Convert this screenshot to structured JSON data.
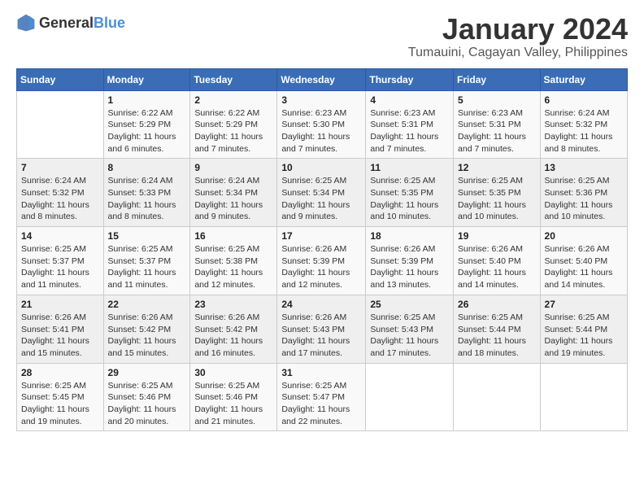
{
  "logo": {
    "text_general": "General",
    "text_blue": "Blue"
  },
  "title": {
    "month": "January 2024",
    "location": "Tumauini, Cagayan Valley, Philippines"
  },
  "weekdays": [
    "Sunday",
    "Monday",
    "Tuesday",
    "Wednesday",
    "Thursday",
    "Friday",
    "Saturday"
  ],
  "weeks": [
    [
      {
        "day": "",
        "info": ""
      },
      {
        "day": "1",
        "info": "Sunrise: 6:22 AM\nSunset: 5:29 PM\nDaylight: 11 hours\nand 6 minutes."
      },
      {
        "day": "2",
        "info": "Sunrise: 6:22 AM\nSunset: 5:29 PM\nDaylight: 11 hours\nand 7 minutes."
      },
      {
        "day": "3",
        "info": "Sunrise: 6:23 AM\nSunset: 5:30 PM\nDaylight: 11 hours\nand 7 minutes."
      },
      {
        "day": "4",
        "info": "Sunrise: 6:23 AM\nSunset: 5:31 PM\nDaylight: 11 hours\nand 7 minutes."
      },
      {
        "day": "5",
        "info": "Sunrise: 6:23 AM\nSunset: 5:31 PM\nDaylight: 11 hours\nand 7 minutes."
      },
      {
        "day": "6",
        "info": "Sunrise: 6:24 AM\nSunset: 5:32 PM\nDaylight: 11 hours\nand 8 minutes."
      }
    ],
    [
      {
        "day": "7",
        "info": "Sunrise: 6:24 AM\nSunset: 5:32 PM\nDaylight: 11 hours\nand 8 minutes."
      },
      {
        "day": "8",
        "info": "Sunrise: 6:24 AM\nSunset: 5:33 PM\nDaylight: 11 hours\nand 8 minutes."
      },
      {
        "day": "9",
        "info": "Sunrise: 6:24 AM\nSunset: 5:34 PM\nDaylight: 11 hours\nand 9 minutes."
      },
      {
        "day": "10",
        "info": "Sunrise: 6:25 AM\nSunset: 5:34 PM\nDaylight: 11 hours\nand 9 minutes."
      },
      {
        "day": "11",
        "info": "Sunrise: 6:25 AM\nSunset: 5:35 PM\nDaylight: 11 hours\nand 10 minutes."
      },
      {
        "day": "12",
        "info": "Sunrise: 6:25 AM\nSunset: 5:35 PM\nDaylight: 11 hours\nand 10 minutes."
      },
      {
        "day": "13",
        "info": "Sunrise: 6:25 AM\nSunset: 5:36 PM\nDaylight: 11 hours\nand 10 minutes."
      }
    ],
    [
      {
        "day": "14",
        "info": "Sunrise: 6:25 AM\nSunset: 5:37 PM\nDaylight: 11 hours\nand 11 minutes."
      },
      {
        "day": "15",
        "info": "Sunrise: 6:25 AM\nSunset: 5:37 PM\nDaylight: 11 hours\nand 11 minutes."
      },
      {
        "day": "16",
        "info": "Sunrise: 6:25 AM\nSunset: 5:38 PM\nDaylight: 11 hours\nand 12 minutes."
      },
      {
        "day": "17",
        "info": "Sunrise: 6:26 AM\nSunset: 5:39 PM\nDaylight: 11 hours\nand 12 minutes."
      },
      {
        "day": "18",
        "info": "Sunrise: 6:26 AM\nSunset: 5:39 PM\nDaylight: 11 hours\nand 13 minutes."
      },
      {
        "day": "19",
        "info": "Sunrise: 6:26 AM\nSunset: 5:40 PM\nDaylight: 11 hours\nand 14 minutes."
      },
      {
        "day": "20",
        "info": "Sunrise: 6:26 AM\nSunset: 5:40 PM\nDaylight: 11 hours\nand 14 minutes."
      }
    ],
    [
      {
        "day": "21",
        "info": "Sunrise: 6:26 AM\nSunset: 5:41 PM\nDaylight: 11 hours\nand 15 minutes."
      },
      {
        "day": "22",
        "info": "Sunrise: 6:26 AM\nSunset: 5:42 PM\nDaylight: 11 hours\nand 15 minutes."
      },
      {
        "day": "23",
        "info": "Sunrise: 6:26 AM\nSunset: 5:42 PM\nDaylight: 11 hours\nand 16 minutes."
      },
      {
        "day": "24",
        "info": "Sunrise: 6:26 AM\nSunset: 5:43 PM\nDaylight: 11 hours\nand 17 minutes."
      },
      {
        "day": "25",
        "info": "Sunrise: 6:25 AM\nSunset: 5:43 PM\nDaylight: 11 hours\nand 17 minutes."
      },
      {
        "day": "26",
        "info": "Sunrise: 6:25 AM\nSunset: 5:44 PM\nDaylight: 11 hours\nand 18 minutes."
      },
      {
        "day": "27",
        "info": "Sunrise: 6:25 AM\nSunset: 5:44 PM\nDaylight: 11 hours\nand 19 minutes."
      }
    ],
    [
      {
        "day": "28",
        "info": "Sunrise: 6:25 AM\nSunset: 5:45 PM\nDaylight: 11 hours\nand 19 minutes."
      },
      {
        "day": "29",
        "info": "Sunrise: 6:25 AM\nSunset: 5:46 PM\nDaylight: 11 hours\nand 20 minutes."
      },
      {
        "day": "30",
        "info": "Sunrise: 6:25 AM\nSunset: 5:46 PM\nDaylight: 11 hours\nand 21 minutes."
      },
      {
        "day": "31",
        "info": "Sunrise: 6:25 AM\nSunset: 5:47 PM\nDaylight: 11 hours\nand 22 minutes."
      },
      {
        "day": "",
        "info": ""
      },
      {
        "day": "",
        "info": ""
      },
      {
        "day": "",
        "info": ""
      }
    ]
  ]
}
